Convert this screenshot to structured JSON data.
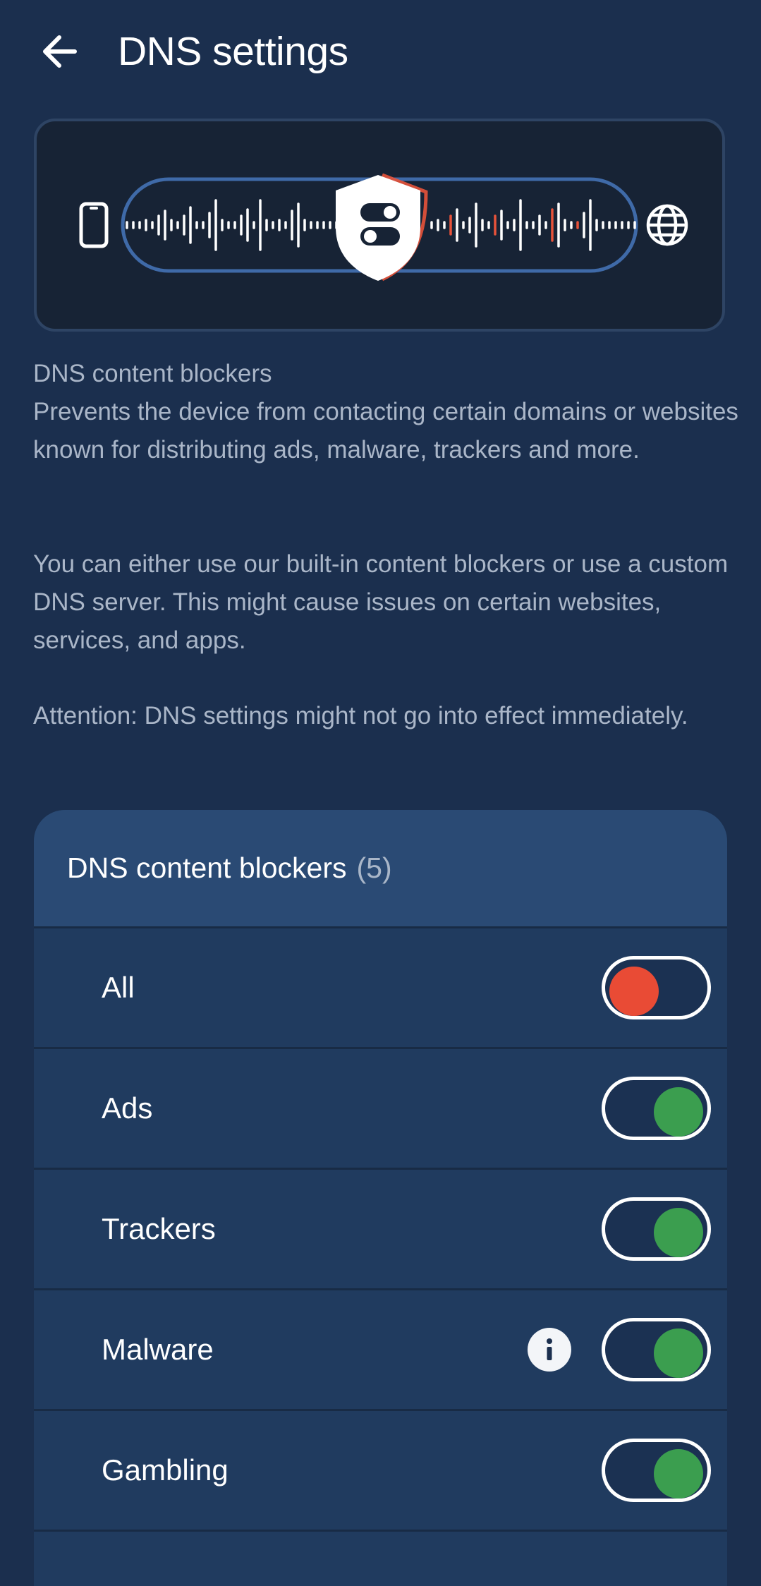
{
  "header": {
    "title": "DNS settings",
    "back_icon": "arrow-left-icon"
  },
  "illustration": {
    "icons": [
      "phone-icon",
      "shield-toggle-icon",
      "globe-icon"
    ],
    "colors": {
      "blocked": "#e8533a",
      "signal": "#ffffff",
      "track": "#3f6aa8"
    }
  },
  "description": {
    "heading": "DNS content blockers",
    "body": "Prevents the device from contacting certain domains or websites known for distributing ads, malware, trackers and more.",
    "paragraph2": "You can either use our built-in content blockers or use a custom DNS server. This might cause issues on certain websites, services, and apps.",
    "attention": "Attention: DNS settings might not go into effect immediately."
  },
  "blockers": {
    "title": "DNS content blockers",
    "count": "(5)",
    "items": [
      {
        "label": "All",
        "enabled": false
      },
      {
        "label": "Ads",
        "enabled": true
      },
      {
        "label": "Trackers",
        "enabled": true
      },
      {
        "label": "Malware",
        "enabled": true,
        "info_icon": "info-icon"
      },
      {
        "label": "Gambling",
        "enabled": true
      }
    ]
  },
  "colors": {
    "background": "#1b2f4e",
    "card": "#203b5f",
    "card_header": "#2a4a74",
    "toggle_on": "#3b9e4f",
    "toggle_off": "#e94b35"
  }
}
